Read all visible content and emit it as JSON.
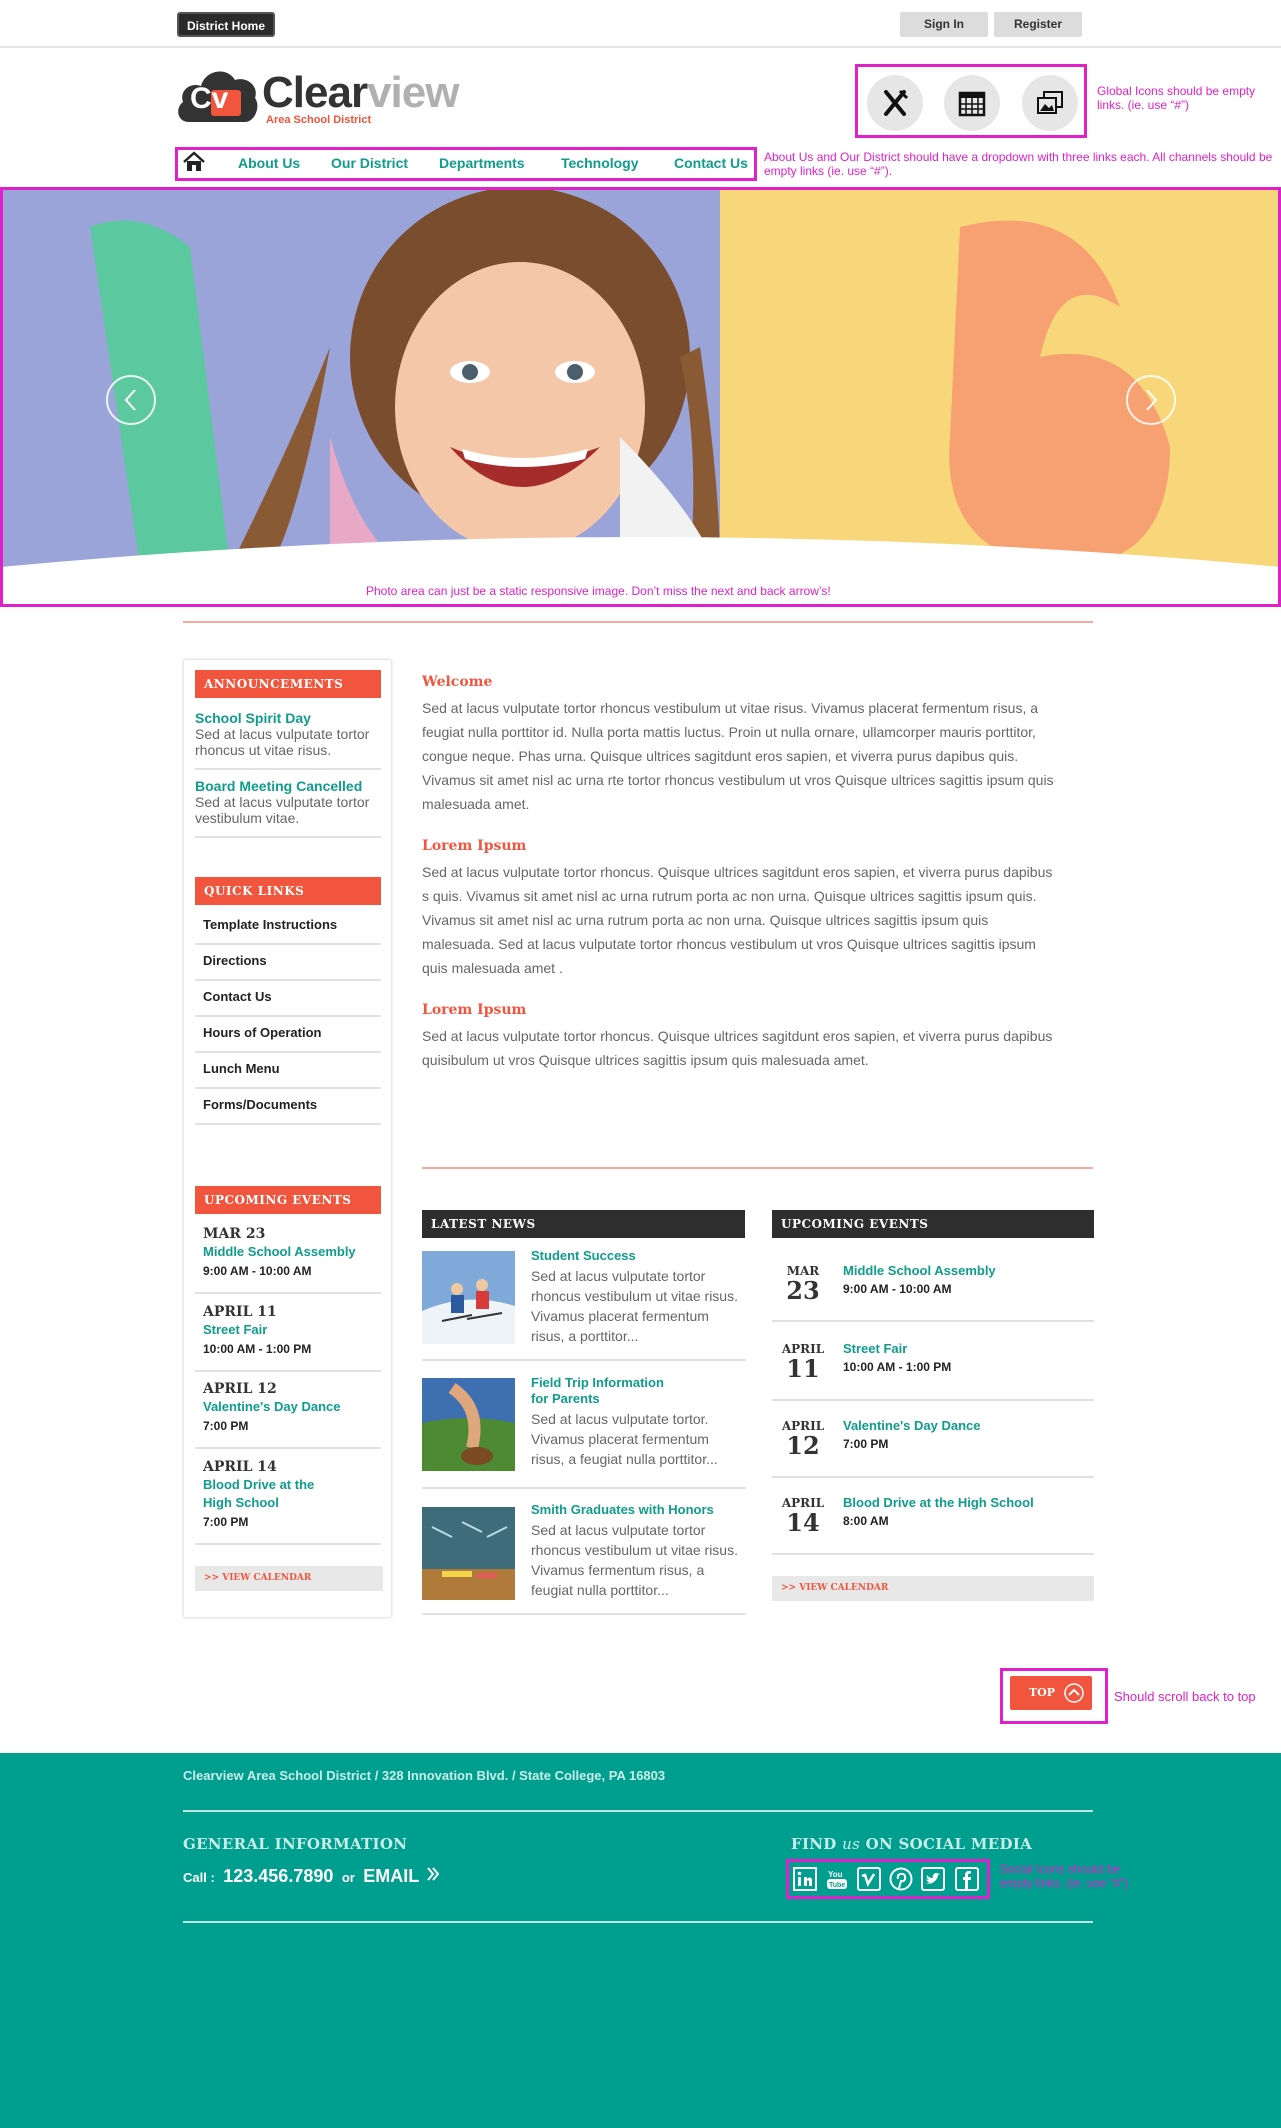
{
  "topbar": {
    "district_home": "District Home",
    "sign_in": "Sign In",
    "register": "Register"
  },
  "logo": {
    "initials": "Cv",
    "word_dark": "Clear",
    "word_light": "view",
    "subtitle": "Area School District"
  },
  "global_icons": {
    "icons": [
      "fork-knife-icon",
      "calendar-icon",
      "photo-gallery-icon"
    ],
    "note": "Global Icons should be empty links. (ie. use “#”)"
  },
  "nav": {
    "items": [
      "About Us",
      "Our District",
      "Departments",
      "Technology",
      "Contact Us"
    ],
    "note": "About Us and Our District should have a dropdown with three links each. All channels should be empty links (ie. use “#”)."
  },
  "hero": {
    "note": "Photo area can just be a static responsive image. Don’t miss the next and back arrow’s!"
  },
  "announcements": {
    "heading": "ANNOUNCEMENTS",
    "items": [
      {
        "title": "School Spirit Day",
        "text": "Sed at lacus vulputate tortor rhoncus ut vitae risus."
      },
      {
        "title": "Board Meeting Cancelled",
        "text": "Sed at lacus vulputate tortor vestibulum vitae."
      }
    ]
  },
  "quick_links": {
    "heading": "QUICK LINKS",
    "items": [
      "Template Instructions",
      "Directions",
      "Contact Us",
      "Hours of Operation",
      "Lunch Menu",
      "Forms/Documents"
    ]
  },
  "sidebar_events": {
    "heading": "UPCOMING EVENTS",
    "items": [
      {
        "date": "MAR 23",
        "title": "Middle School Assembly",
        "time": "9:00 AM - 10:00 AM"
      },
      {
        "date": "APRIL 11",
        "title": "Street Fair",
        "time": "10:00 AM - 1:00 PM"
      },
      {
        "date": "APRIL 12",
        "title": "Valentine's Day Dance",
        "time": "7:00 PM"
      },
      {
        "date": "APRIL 14",
        "title": "Blood Drive at the High School",
        "time": "7:00 PM"
      }
    ],
    "view_calendar": ">> VIEW CALENDAR"
  },
  "main": {
    "sections": [
      {
        "title": "Welcome",
        "body": "Sed at lacus vulputate tortor rhoncus vestibulum ut vitae risus. Vivamus placerat fermentum risus, a feugiat nulla porttitor id. Nulla porta mattis luctus. Proin ut nulla ornare, ullamcorper mauris porttitor, congue neque. Phas urna. Quisque ultrices sagitdunt eros sapien, et viverra purus dapibus quis. Vivamus sit amet nisl ac urna rte tortor rhoncus vestibulum ut vros Quisque ultrices sagittis ipsum quis malesuada amet."
      },
      {
        "title": "Lorem Ipsum",
        "body": "Sed at lacus vulputate tortor rhoncus. Quisque ultrices sagitdunt eros sapien, et viverra purus dapibus s quis. Vivamus sit amet nisl ac urna rutrum porta ac non urna. Quisque ultrices sagittis ipsum quis. Vivamus sit amet nisl ac urna rutrum porta ac non urna. Quisque ultrices sagittis ipsum quis malesuada. Sed at lacus vulputate tortor rhoncus vestibulum ut vros Quisque ultrices sagittis ipsum quis malesuada amet ."
      },
      {
        "title": "Lorem Ipsum",
        "body": "Sed at lacus vulputate tortor rhoncus. Quisque ultrices sagitdunt eros sapien, et viverra purus dapibus quisibulum ut vros Quisque ultrices sagittis ipsum quis malesuada amet."
      }
    ]
  },
  "latest_news": {
    "heading": "LATEST NEWS",
    "items": [
      {
        "title": "Student Success",
        "text": "Sed at lacus vulputate tortor rhoncus vestibulum ut vitae risus. Vivamus placerat fermentum risus, a porttitor..."
      },
      {
        "title": "Field Trip Information for Parents",
        "text": "Sed at lacus vulputate tortor. Vivamus placerat fermentum risus, a feugiat nulla porttitor..."
      },
      {
        "title": "Smith Graduates with Honors",
        "text": "Sed at lacus vulputate tortor rhoncus vestibulum ut vitae risus. Vivamus fermentum risus, a feugiat nulla porttitor..."
      }
    ]
  },
  "upcoming_events": {
    "heading": "UPCOMING EVENTS",
    "items": [
      {
        "month": "MAR",
        "day": "23",
        "title": "Middle School Assembly",
        "time": "9:00 AM - 10:00 AM"
      },
      {
        "month": "APRIL",
        "day": "11",
        "title": "Street Fair",
        "time": "10:00 AM - 1:00 PM"
      },
      {
        "month": "APRIL",
        "day": "12",
        "title": "Valentine's Day Dance",
        "time": "7:00 PM"
      },
      {
        "month": "APRIL",
        "day": "14",
        "title": "Blood Drive at the High School",
        "time": "8:00 AM"
      }
    ],
    "view_calendar": ">> VIEW CALENDAR"
  },
  "top_button": {
    "label": "TOP",
    "note": "Should scroll back to top"
  },
  "footer": {
    "address": "Clearview Area School District  /  328 Innovation Blvd.  /  State College, PA 16803",
    "general_heading": "GENERAL INFORMATION",
    "call_label": "Call :",
    "phone": "123.456.7890",
    "or": "or",
    "email": "EMAIL",
    "social_heading_a": "FIND",
    "social_heading_us": "us",
    "social_heading_b": "ON SOCIAL MEDIA",
    "social_icons": [
      "linkedin-icon",
      "youtube-icon",
      "vimeo-icon",
      "pinterest-icon",
      "twitter-icon",
      "facebook-icon"
    ],
    "social_note": "Social Icons should be empty links. (ie. use “#”)"
  },
  "colors": {
    "accent_red": "#f2553d",
    "teal": "#0f9c8c",
    "footer_teal": "#009e8f",
    "annotation_magenta": "#e020c8"
  }
}
